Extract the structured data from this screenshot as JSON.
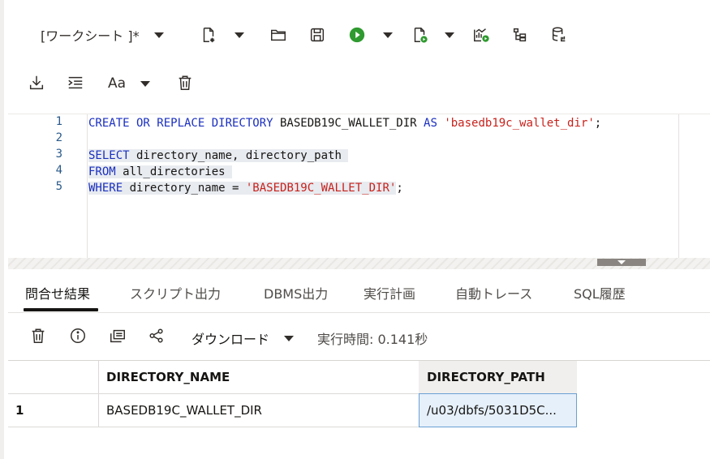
{
  "toolbar": {
    "worksheet_label": "[ワークシート ]*",
    "icons": [
      "new-file-icon",
      "open-folder-icon",
      "save-icon",
      "run-statement-icon",
      "run-script-icon",
      "explain-plan-icon",
      "autotrace-icon",
      "database-icon"
    ]
  },
  "toolbar2": {
    "icons": [
      "download-icon",
      "format-icon",
      "font-case-icon",
      "clear-icon"
    ],
    "font_case_label": "Aa"
  },
  "editor": {
    "line_numbers": [
      "1",
      "2",
      "3",
      "4",
      "5"
    ],
    "lines": [
      {
        "parts": [
          {
            "t": "CREATE OR REPLACE DIRECTORY",
            "c": "kw"
          },
          {
            "t": " BASEDB19C_WALLET_DIR ",
            "c": "txt"
          },
          {
            "t": "AS",
            "c": "kw"
          },
          {
            "t": " ",
            "c": "txt"
          },
          {
            "t": "'basedb19c_wallet_dir'",
            "c": "str"
          },
          {
            "t": ";",
            "c": "txt"
          }
        ]
      },
      {
        "parts": []
      },
      {
        "parts": [
          {
            "t": "SELECT",
            "c": "kw"
          },
          {
            "t": " directory_name, directory_path ",
            "c": "txt"
          }
        ],
        "hl": true
      },
      {
        "parts": [
          {
            "t": "FROM",
            "c": "kw"
          },
          {
            "t": " all_directories ",
            "c": "txt"
          }
        ],
        "hl": true
      },
      {
        "parts": [
          {
            "t": "WHERE",
            "c": "kw"
          },
          {
            "t": " directory_name = ",
            "c": "txt"
          },
          {
            "t": "'BASEDB19C_WALLET_DIR'",
            "c": "str"
          }
        ],
        "hl": true,
        "tail": ";"
      }
    ]
  },
  "tabs": [
    {
      "label": "問合せ結果",
      "active": true
    },
    {
      "label": "スクリプト出力"
    },
    {
      "label": "DBMS出力"
    },
    {
      "label": "実行計画"
    },
    {
      "label": "自動トレース"
    },
    {
      "label": "SQL履歴"
    }
  ],
  "result_toolbar": {
    "download_label": "ダウンロード",
    "exec_time": "実行時間: 0.141秒"
  },
  "grid": {
    "columns": [
      "DIRECTORY_NAME",
      "DIRECTORY_PATH"
    ],
    "rows": [
      {
        "num": "1",
        "cells": [
          "BASEDB19C_WALLET_DIR",
          "/u03/dbfs/5031D5C..."
        ]
      }
    ]
  }
}
